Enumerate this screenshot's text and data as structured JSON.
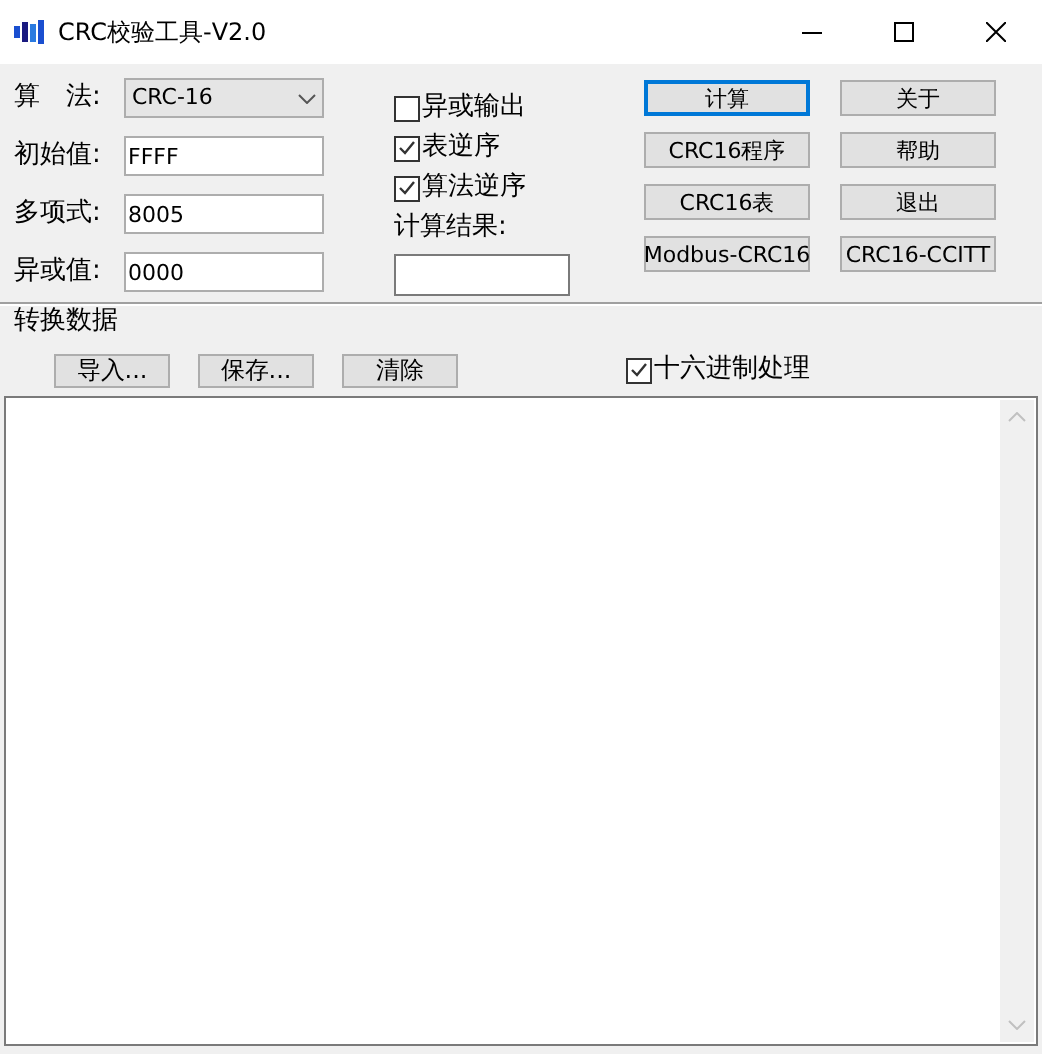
{
  "window": {
    "title": "CRC校验工具-V2.0"
  },
  "fields": [
    {
      "label": "算　法:",
      "kind": "select",
      "value": "CRC-16"
    },
    {
      "label": "初始值:",
      "kind": "text",
      "value": "FFFF"
    },
    {
      "label": "多项式:",
      "kind": "text",
      "value": "8005"
    },
    {
      "label": "异或值:",
      "kind": "text",
      "value": "0000"
    }
  ],
  "options": [
    {
      "label": "异或输出",
      "checked": false
    },
    {
      "label": "表逆序",
      "checked": true
    },
    {
      "label": "算法逆序",
      "checked": true
    }
  ],
  "result": {
    "label": "计算结果:"
  },
  "buttons": [
    {
      "label": "计算",
      "focused": true
    },
    {
      "label": "关于",
      "focused": false
    },
    {
      "label": "CRC16程序",
      "focused": false
    },
    {
      "label": "帮助",
      "focused": false
    },
    {
      "label": "CRC16表",
      "focused": false
    },
    {
      "label": "退出",
      "focused": false
    },
    {
      "label": "Modbus-CRC16",
      "focused": false
    },
    {
      "label": "CRC16-CCITT",
      "focused": false
    }
  ],
  "group": {
    "title": "转换数据",
    "buttons": [
      "导入...",
      "保存...",
      "清除"
    ],
    "hex_option": {
      "label": "十六进制处理",
      "checked": true
    }
  }
}
